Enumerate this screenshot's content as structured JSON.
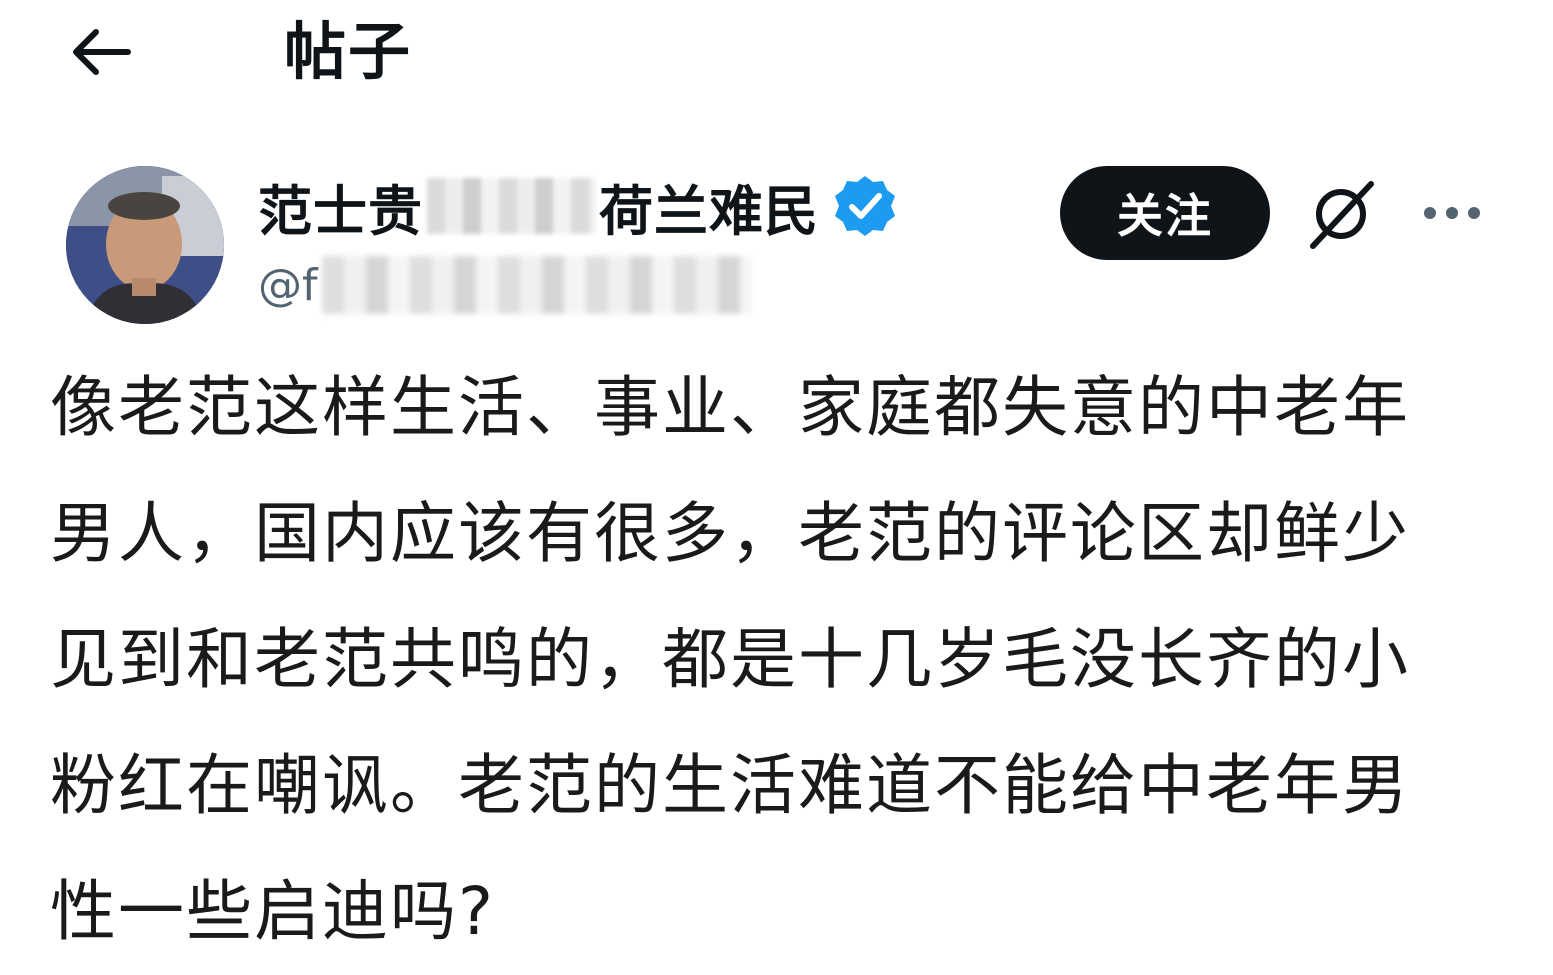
{
  "header": {
    "title": "帖子"
  },
  "author": {
    "name_prefix": "范士贵",
    "name_suffix": "荷兰难民",
    "handle_prefix": "@f",
    "verified": true,
    "verified_color": "#1d9bf0"
  },
  "actions": {
    "follow_label": "关注"
  },
  "post": {
    "text": "像老范这样生活、事业、家庭都失意的中老年男人，国内应该有很多，老范的评论区却鲜少见到和老范共鸣的，都是十几岁毛没长齐的小粉红在嘲讽。老范的生活难道不能给中老年男性一些启迪吗?"
  },
  "icons": {
    "back": "back-arrow-icon",
    "verified": "verified-badge-icon",
    "grok": "grok-icon",
    "more": "more-icon"
  },
  "colors": {
    "text": "#0f1419",
    "secondary": "#536471",
    "follow_bg": "#0f1419",
    "follow_text": "#ffffff"
  }
}
